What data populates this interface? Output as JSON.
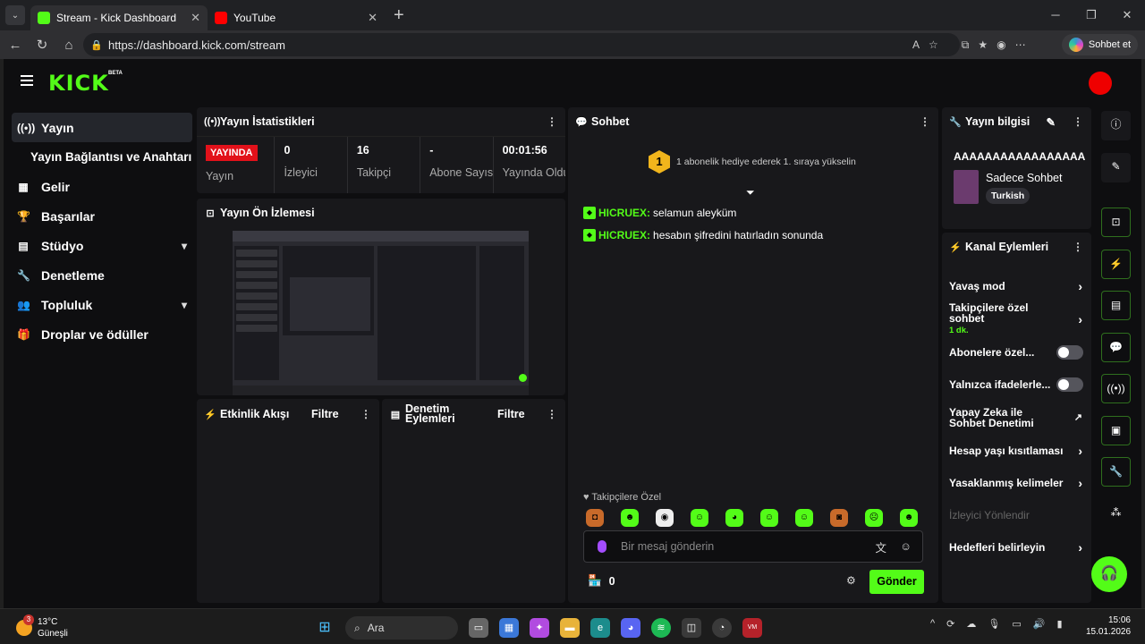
{
  "browser": {
    "tabs": [
      {
        "title": "Stream - Kick Dashboard",
        "active": true,
        "color": "#53fc18"
      },
      {
        "title": "YouTube",
        "active": false,
        "color": "#ff0000"
      }
    ],
    "url": "https://dashboard.kick.com/stream",
    "copilot_label": "Sohbet et"
  },
  "app": {
    "logo": "KICK",
    "logo_badge": "BETA",
    "accent_color": "#53fc18",
    "live_color": "#e2111a"
  },
  "sidebar": {
    "items": [
      {
        "label": "Yayın",
        "icon": "broadcast-icon",
        "active": true
      },
      {
        "label": "Yayın Bağlantısı ve Anahtarı",
        "icon": "",
        "sub": true
      },
      {
        "label": "Gelir",
        "icon": "chart-icon"
      },
      {
        "label": "Başarılar",
        "icon": "trophy-icon"
      },
      {
        "label": "Stüdyo",
        "icon": "studio-icon",
        "expandable": true
      },
      {
        "label": "Denetleme",
        "icon": "wrench-icon"
      },
      {
        "label": "Topluluk",
        "icon": "people-icon",
        "expandable": true
      },
      {
        "label": "Droplar ve ödüller",
        "icon": "gift-icon"
      }
    ]
  },
  "stats_panel": {
    "title": "Yayın İstatistikleri",
    "live_badge": "YAYINDA",
    "stats": [
      {
        "value": "YAYINDA",
        "label": "Yayın"
      },
      {
        "value": "0",
        "label": "İzleyici"
      },
      {
        "value": "16",
        "label": "Takipçi"
      },
      {
        "value": "-",
        "label": "Abone Sayısı"
      },
      {
        "value": "00:01:56",
        "label": "Yayında Olduğu"
      }
    ]
  },
  "preview_panel": {
    "title": "Yayın Ön İzlemesi"
  },
  "activity_panel": {
    "title": "Etkinlik Akışı",
    "filter": "Filtre"
  },
  "mod_panel": {
    "title": "Denetim Eylemleri",
    "filter": "Filtre"
  },
  "chat": {
    "title": "Sohbet",
    "gift_rank": "1",
    "gift_text": "1 abonelik hediye ederek 1. sıraya yükselin",
    "messages": [
      {
        "user": "HICRUEX:",
        "text": "selamun aleyküm"
      },
      {
        "user": "HICRUEX:",
        "text": "hesabın şifredini hatırladın sonunda"
      }
    ],
    "followers_only": "Takipçilere Özel",
    "input_placeholder": "Bir mesaj gönderin",
    "send_label": "Gönder",
    "viewer_count": "0"
  },
  "stream_info": {
    "title": "Yayın bilgisi",
    "stream_title": "AAAAAAAAAAAAAAAAA",
    "category": "Sadece Sohbet",
    "language": "Turkish"
  },
  "channel_actions": {
    "title": "Kanal Eylemleri",
    "items": [
      {
        "label": "Yavaş mod",
        "type": "arrow"
      },
      {
        "label": "Takipçilere özel sohbet",
        "sub": "1 dk.",
        "type": "arrow"
      },
      {
        "label": "Abonelere özel...",
        "type": "toggle"
      },
      {
        "label": "Yalnızca ifadelerle...",
        "type": "toggle"
      },
      {
        "label": "Yapay Zeka ile Sohbet Denetimi",
        "type": "external"
      },
      {
        "label": "Hesap yaşı kısıtlaması",
        "type": "arrow"
      },
      {
        "label": "Yasaklanmış kelimeler",
        "type": "arrow"
      },
      {
        "label": "İzleyici Yönlendir",
        "type": "disabled"
      },
      {
        "label": "Hedefleri belirleyin",
        "type": "arrow"
      }
    ]
  },
  "taskbar": {
    "weather_temp": "13°C",
    "weather_desc": "Güneşli",
    "weather_badge": "3",
    "search_label": "Ara",
    "time": "15:06",
    "date": "15.01.2026"
  }
}
